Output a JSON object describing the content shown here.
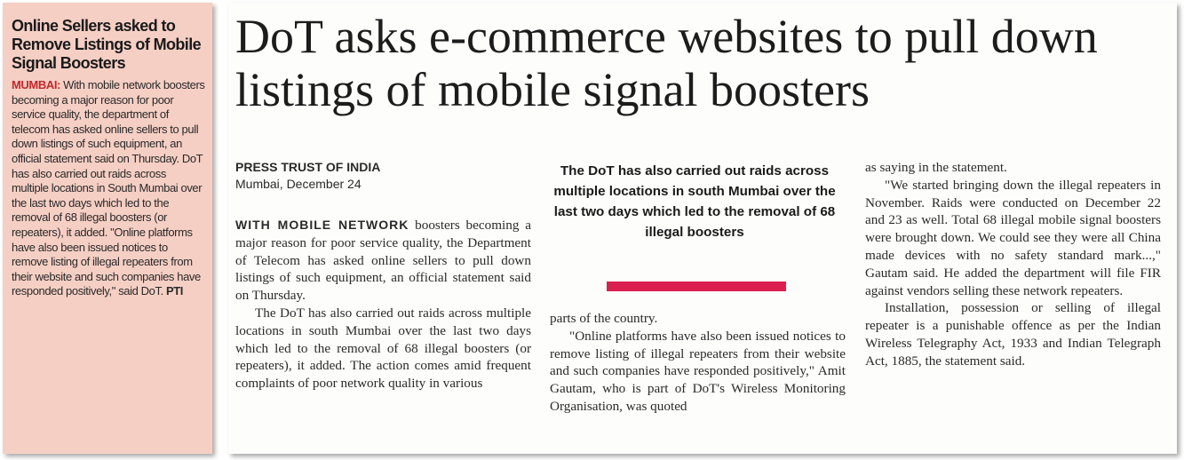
{
  "left_clip": {
    "headline": "Online Sellers asked to Remove Listings of Mobile Signal Boosters",
    "dateline": "MUMBAI:",
    "body": " With mobile network boosters becoming a major reason for poor service quality, the department of telecom has asked online sellers to pull down listings of such equipment, an official statement said on Thursday. DoT has also carried out raids across multiple locations in South Mumbai over the last two days which led to the removal of 68 illegal boosters (or repeaters), it added. \"Online platforms have also been issued notices to remove listing of illegal repeaters from their website and such companies have responded positively,\" said DoT. ",
    "credit": "PTI"
  },
  "article": {
    "headline": "DoT asks e-commerce websites to pull down listings of mobile signal boosters",
    "agency": "PRESS TRUST OF INDIA",
    "place_date": "Mumbai, December 24",
    "lead_in": "WITH MOBILE NETWORK",
    "para1": " boosters becoming a major reason for poor service quality, the Department of Telecom has asked online sellers to pull down listings of such equipment, an official statement said on Thursday.",
    "para2": "The DoT has also carried out raids across multiple locations in south Mumbai over the last two days which led to the removal of 68 illegal boosters (or repeaters), it added. The action comes amid frequent complaints of poor network quality in various",
    "pull_quote": "The DoT has also carried out raids across multiple locations in south Mumbai over the last two days which led to the removal of 68 illegal boosters",
    "col2_cont": "parts of the country.",
    "para3": "\"Online platforms have also been issued notices to remove listing of illegal repeaters from their website and such companies have responded positively,\" Amit Gautam, who is part of DoT's Wireless Monitoring Organisation, was quoted",
    "col3_cont": "as saying in the statement.",
    "para4": "\"We started bringing down the illegal repeaters in November. Raids were conducted on December 22 and 23 as well. Total 68 illegal mobile signal boosters were brought down. We could see they were all China made devices with no safety standard mark...,\" Gautam said. He added the department will file FIR against vendors selling these network repeaters.",
    "para5": "Installation, possession or selling of illegal repeater is a punishable offence as per the Indian Wireless Telegraphy Act, 1933 and Indian Telegraph Act, 1885, the statement said."
  },
  "colors": {
    "left_clip_bg": "#f6cfc4",
    "dateline_red": "#c0282c",
    "pull_bar": "#d9204f"
  }
}
